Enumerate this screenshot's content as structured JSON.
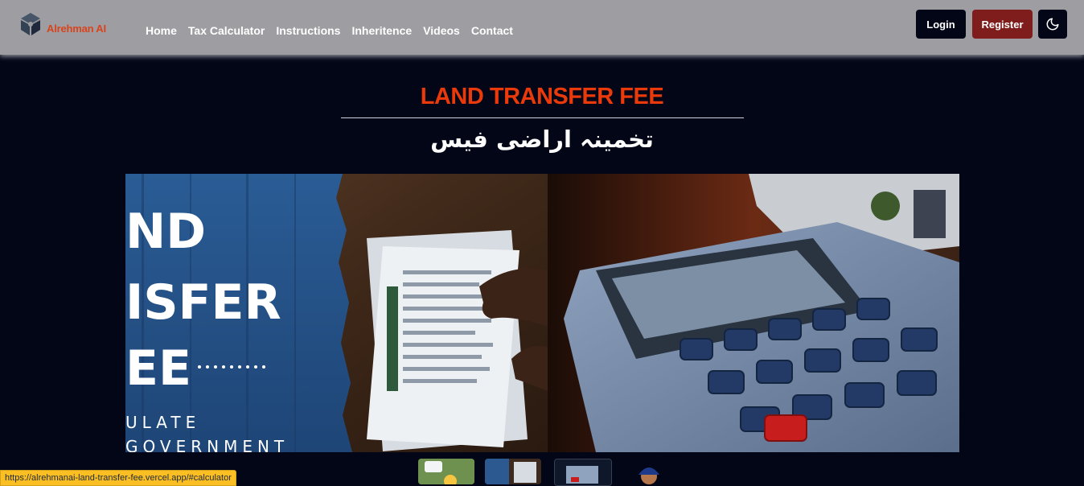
{
  "header": {
    "brand": "Alrehman AI",
    "brand_icon": "cube-logo-icon",
    "nav": [
      "Home",
      "Tax Calculator",
      "Instructions",
      "Inheritence",
      "Videos",
      "Contact"
    ],
    "login_label": "Login",
    "register_label": "Register",
    "theme_icon": "moon-icon"
  },
  "main": {
    "title": "LAND TRANSFER FEE",
    "subtitle": "تخمینہ اراضی فیس",
    "hero_text_lines": [
      "ND",
      "ISFER",
      "EE",
      "ULATE",
      "GOVERNMENT"
    ]
  },
  "status_bar": {
    "url": "https://alrehmanai-land-transfer-fee.vercel.app/#calculator"
  },
  "colors": {
    "header_bg": "#9d9da2",
    "page_bg": "#020617",
    "accent": "#ea3a0c",
    "register_bg": "#7f1d1d"
  }
}
